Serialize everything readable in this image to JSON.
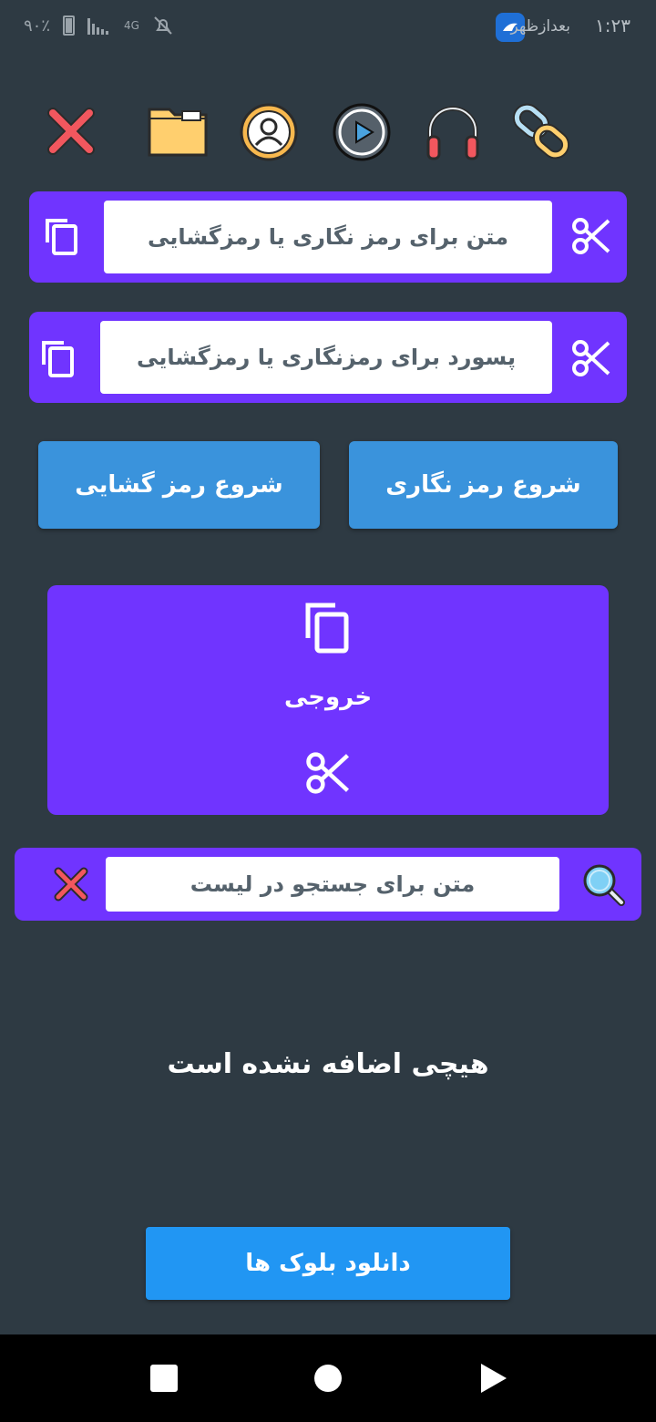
{
  "status_bar": {
    "time": "۱:۲۳",
    "ampm": "بعدازظهر",
    "battery": "۹۰٪",
    "network": "4G"
  },
  "toolbar": {
    "icons": [
      "close-x-icon",
      "folder-icon",
      "user-avatar-icon",
      "play-icon",
      "headphones-icon",
      "link-icon"
    ]
  },
  "text_input": {
    "placeholder": "متن برای رمز نگاری یا رمزگشایی"
  },
  "password_input": {
    "placeholder": "پسورد برای رمزنگاری یا رمزگشایی"
  },
  "actions": {
    "encrypt_label": "شروع رمز نگاری",
    "decrypt_label": "شروع رمز گشایی"
  },
  "output": {
    "label": "خروجی"
  },
  "search": {
    "placeholder": "متن برای جستجو در لیست"
  },
  "list": {
    "empty_message": "هیچی اضافه نشده است"
  },
  "download": {
    "label": "دانلود بلوک ها"
  },
  "colors": {
    "background": "#2e3a43",
    "card_purple": "#7034ff",
    "button_blue": "#3a93dc",
    "download_blue": "#2196f3"
  }
}
